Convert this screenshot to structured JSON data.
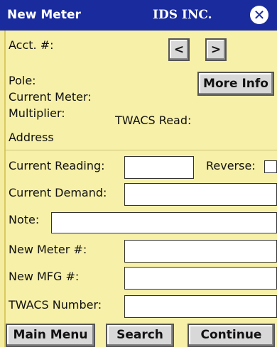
{
  "window": {
    "title": "New Meter",
    "company": "IDS INC.",
    "close_icon": "close-icon"
  },
  "account": {
    "label": "Acct. #:",
    "prev_label": "<",
    "next_label": ">"
  },
  "info": {
    "pole_label": "Pole:",
    "current_meter_label": "Current Meter:",
    "multiplier_label": "Multiplier:",
    "twacs_read_label": "TWACS Read:",
    "address_label": "Address",
    "more_info_label": "More Info"
  },
  "form": {
    "current_reading_label": "Current Reading:",
    "current_reading_value": "",
    "reverse_label": "Reverse:",
    "current_demand_label": "Current Demand:",
    "current_demand_value": "",
    "note_label": "Note:",
    "note_value": "",
    "new_meter_label": "New Meter #:",
    "new_meter_value": "",
    "new_mfg_label": "New MFG #:",
    "new_mfg_value": "",
    "twacs_number_label": "TWACS Number:",
    "twacs_number_value": ""
  },
  "footer": {
    "main_menu_label": "Main Menu",
    "search_label": "Search",
    "continue_label": "Continue"
  },
  "colors": {
    "titlebar": "#1a2b9e",
    "background": "#f7f0a8"
  }
}
